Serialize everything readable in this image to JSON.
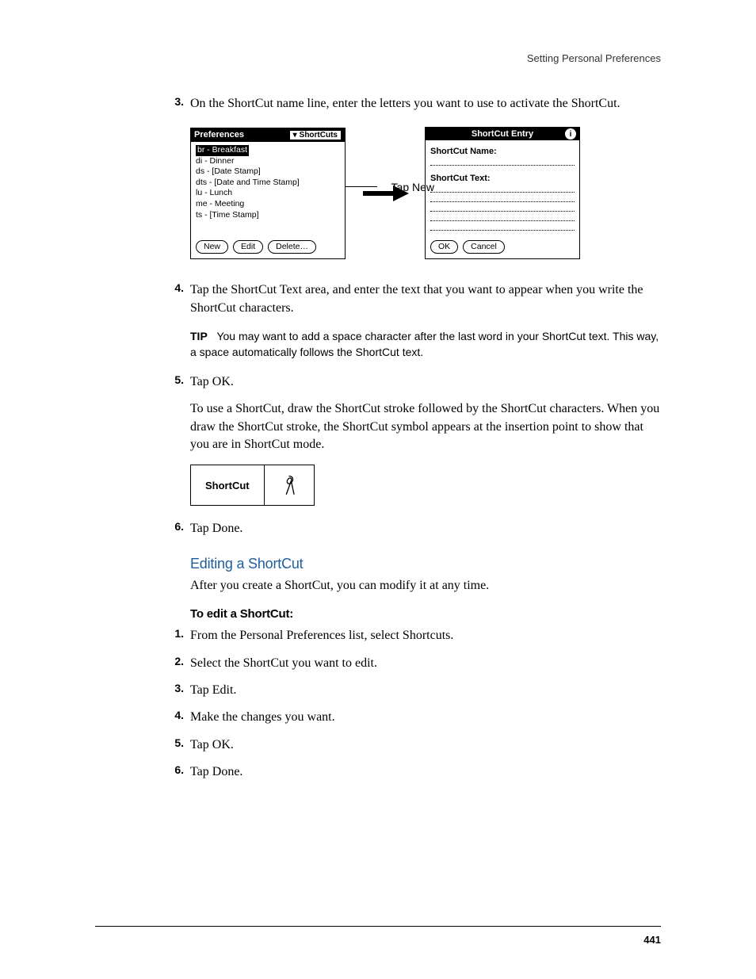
{
  "header": "Setting Personal Preferences",
  "page_number": "441",
  "steps_a": [
    {
      "num": "3.",
      "text": "On the ShortCut name line, enter the letters you want to use to activate the ShortCut."
    }
  ],
  "figure": {
    "prefs_title": "Preferences",
    "dropdown": "ShortCuts",
    "list": [
      "br - Breakfast",
      "di - Dinner",
      "ds - [Date Stamp]",
      "dts - [Date and Time Stamp]",
      "lu - Lunch",
      "me - Meeting",
      "ts - [Time Stamp]"
    ],
    "btn_new": "New",
    "btn_edit": "Edit",
    "btn_delete": "Delete…",
    "tap_new": "Tap New",
    "entry_title": "ShortCut Entry",
    "entry_name_label": "ShortCut Name:",
    "entry_text_label": "ShortCut Text:",
    "btn_ok": "OK",
    "btn_cancel": "Cancel"
  },
  "steps_b": [
    {
      "num": "4.",
      "text": "Tap the ShortCut Text area, and enter the text that you want to appear when you write the ShortCut characters."
    }
  ],
  "tip_label": "TIP",
  "tip_text": "You may want to add a space character after the last word in your ShortCut text. This way, a space automatically follows the ShortCut text.",
  "steps_c": [
    {
      "num": "5.",
      "text": "Tap OK."
    }
  ],
  "usage_para": "To use a ShortCut, draw the ShortCut stroke followed by the ShortCut characters. When you draw the ShortCut stroke, the ShortCut symbol appears at the insertion point to show that you are in ShortCut mode.",
  "sc_label": "ShortCut",
  "steps_d": [
    {
      "num": "6.",
      "text": "Tap Done."
    }
  ],
  "heading_edit": "Editing a ShortCut",
  "edit_intro": "After you create a ShortCut, you can modify it at any time.",
  "heading_toedit": "To edit a ShortCut:",
  "edit_steps": [
    {
      "num": "1.",
      "text": "From the Personal Preferences list, select Shortcuts."
    },
    {
      "num": "2.",
      "text": "Select the ShortCut you want to edit."
    },
    {
      "num": "3.",
      "text": "Tap Edit."
    },
    {
      "num": "4.",
      "text": "Make the changes you want."
    },
    {
      "num": "5.",
      "text": "Tap OK."
    },
    {
      "num": "6.",
      "text": "Tap Done."
    }
  ]
}
